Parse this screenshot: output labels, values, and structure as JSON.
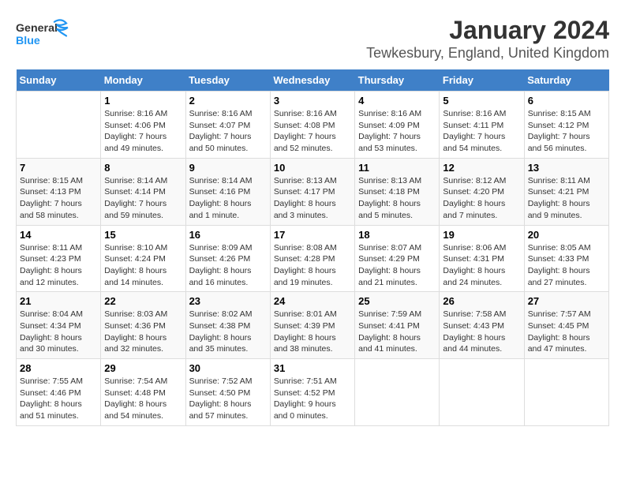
{
  "logo": {
    "general": "General",
    "blue": "Blue"
  },
  "title": "January 2024",
  "subtitle": "Tewkesbury, England, United Kingdom",
  "days_of_week": [
    "Sunday",
    "Monday",
    "Tuesday",
    "Wednesday",
    "Thursday",
    "Friday",
    "Saturday"
  ],
  "weeks": [
    [
      {
        "day": "",
        "sunrise": "",
        "sunset": "",
        "daylight": ""
      },
      {
        "day": "1",
        "sunrise": "Sunrise: 8:16 AM",
        "sunset": "Sunset: 4:06 PM",
        "daylight": "Daylight: 7 hours and 49 minutes."
      },
      {
        "day": "2",
        "sunrise": "Sunrise: 8:16 AM",
        "sunset": "Sunset: 4:07 PM",
        "daylight": "Daylight: 7 hours and 50 minutes."
      },
      {
        "day": "3",
        "sunrise": "Sunrise: 8:16 AM",
        "sunset": "Sunset: 4:08 PM",
        "daylight": "Daylight: 7 hours and 52 minutes."
      },
      {
        "day": "4",
        "sunrise": "Sunrise: 8:16 AM",
        "sunset": "Sunset: 4:09 PM",
        "daylight": "Daylight: 7 hours and 53 minutes."
      },
      {
        "day": "5",
        "sunrise": "Sunrise: 8:16 AM",
        "sunset": "Sunset: 4:11 PM",
        "daylight": "Daylight: 7 hours and 54 minutes."
      },
      {
        "day": "6",
        "sunrise": "Sunrise: 8:15 AM",
        "sunset": "Sunset: 4:12 PM",
        "daylight": "Daylight: 7 hours and 56 minutes."
      }
    ],
    [
      {
        "day": "7",
        "sunrise": "Sunrise: 8:15 AM",
        "sunset": "Sunset: 4:13 PM",
        "daylight": "Daylight: 7 hours and 58 minutes."
      },
      {
        "day": "8",
        "sunrise": "Sunrise: 8:14 AM",
        "sunset": "Sunset: 4:14 PM",
        "daylight": "Daylight: 7 hours and 59 minutes."
      },
      {
        "day": "9",
        "sunrise": "Sunrise: 8:14 AM",
        "sunset": "Sunset: 4:16 PM",
        "daylight": "Daylight: 8 hours and 1 minute."
      },
      {
        "day": "10",
        "sunrise": "Sunrise: 8:13 AM",
        "sunset": "Sunset: 4:17 PM",
        "daylight": "Daylight: 8 hours and 3 minutes."
      },
      {
        "day": "11",
        "sunrise": "Sunrise: 8:13 AM",
        "sunset": "Sunset: 4:18 PM",
        "daylight": "Daylight: 8 hours and 5 minutes."
      },
      {
        "day": "12",
        "sunrise": "Sunrise: 8:12 AM",
        "sunset": "Sunset: 4:20 PM",
        "daylight": "Daylight: 8 hours and 7 minutes."
      },
      {
        "day": "13",
        "sunrise": "Sunrise: 8:11 AM",
        "sunset": "Sunset: 4:21 PM",
        "daylight": "Daylight: 8 hours and 9 minutes."
      }
    ],
    [
      {
        "day": "14",
        "sunrise": "Sunrise: 8:11 AM",
        "sunset": "Sunset: 4:23 PM",
        "daylight": "Daylight: 8 hours and 12 minutes."
      },
      {
        "day": "15",
        "sunrise": "Sunrise: 8:10 AM",
        "sunset": "Sunset: 4:24 PM",
        "daylight": "Daylight: 8 hours and 14 minutes."
      },
      {
        "day": "16",
        "sunrise": "Sunrise: 8:09 AM",
        "sunset": "Sunset: 4:26 PM",
        "daylight": "Daylight: 8 hours and 16 minutes."
      },
      {
        "day": "17",
        "sunrise": "Sunrise: 8:08 AM",
        "sunset": "Sunset: 4:28 PM",
        "daylight": "Daylight: 8 hours and 19 minutes."
      },
      {
        "day": "18",
        "sunrise": "Sunrise: 8:07 AM",
        "sunset": "Sunset: 4:29 PM",
        "daylight": "Daylight: 8 hours and 21 minutes."
      },
      {
        "day": "19",
        "sunrise": "Sunrise: 8:06 AM",
        "sunset": "Sunset: 4:31 PM",
        "daylight": "Daylight: 8 hours and 24 minutes."
      },
      {
        "day": "20",
        "sunrise": "Sunrise: 8:05 AM",
        "sunset": "Sunset: 4:33 PM",
        "daylight": "Daylight: 8 hours and 27 minutes."
      }
    ],
    [
      {
        "day": "21",
        "sunrise": "Sunrise: 8:04 AM",
        "sunset": "Sunset: 4:34 PM",
        "daylight": "Daylight: 8 hours and 30 minutes."
      },
      {
        "day": "22",
        "sunrise": "Sunrise: 8:03 AM",
        "sunset": "Sunset: 4:36 PM",
        "daylight": "Daylight: 8 hours and 32 minutes."
      },
      {
        "day": "23",
        "sunrise": "Sunrise: 8:02 AM",
        "sunset": "Sunset: 4:38 PM",
        "daylight": "Daylight: 8 hours and 35 minutes."
      },
      {
        "day": "24",
        "sunrise": "Sunrise: 8:01 AM",
        "sunset": "Sunset: 4:39 PM",
        "daylight": "Daylight: 8 hours and 38 minutes."
      },
      {
        "day": "25",
        "sunrise": "Sunrise: 7:59 AM",
        "sunset": "Sunset: 4:41 PM",
        "daylight": "Daylight: 8 hours and 41 minutes."
      },
      {
        "day": "26",
        "sunrise": "Sunrise: 7:58 AM",
        "sunset": "Sunset: 4:43 PM",
        "daylight": "Daylight: 8 hours and 44 minutes."
      },
      {
        "day": "27",
        "sunrise": "Sunrise: 7:57 AM",
        "sunset": "Sunset: 4:45 PM",
        "daylight": "Daylight: 8 hours and 47 minutes."
      }
    ],
    [
      {
        "day": "28",
        "sunrise": "Sunrise: 7:55 AM",
        "sunset": "Sunset: 4:46 PM",
        "daylight": "Daylight: 8 hours and 51 minutes."
      },
      {
        "day": "29",
        "sunrise": "Sunrise: 7:54 AM",
        "sunset": "Sunset: 4:48 PM",
        "daylight": "Daylight: 8 hours and 54 minutes."
      },
      {
        "day": "30",
        "sunrise": "Sunrise: 7:52 AM",
        "sunset": "Sunset: 4:50 PM",
        "daylight": "Daylight: 8 hours and 57 minutes."
      },
      {
        "day": "31",
        "sunrise": "Sunrise: 7:51 AM",
        "sunset": "Sunset: 4:52 PM",
        "daylight": "Daylight: 9 hours and 0 minutes."
      },
      {
        "day": "",
        "sunrise": "",
        "sunset": "",
        "daylight": ""
      },
      {
        "day": "",
        "sunrise": "",
        "sunset": "",
        "daylight": ""
      },
      {
        "day": "",
        "sunrise": "",
        "sunset": "",
        "daylight": ""
      }
    ]
  ]
}
